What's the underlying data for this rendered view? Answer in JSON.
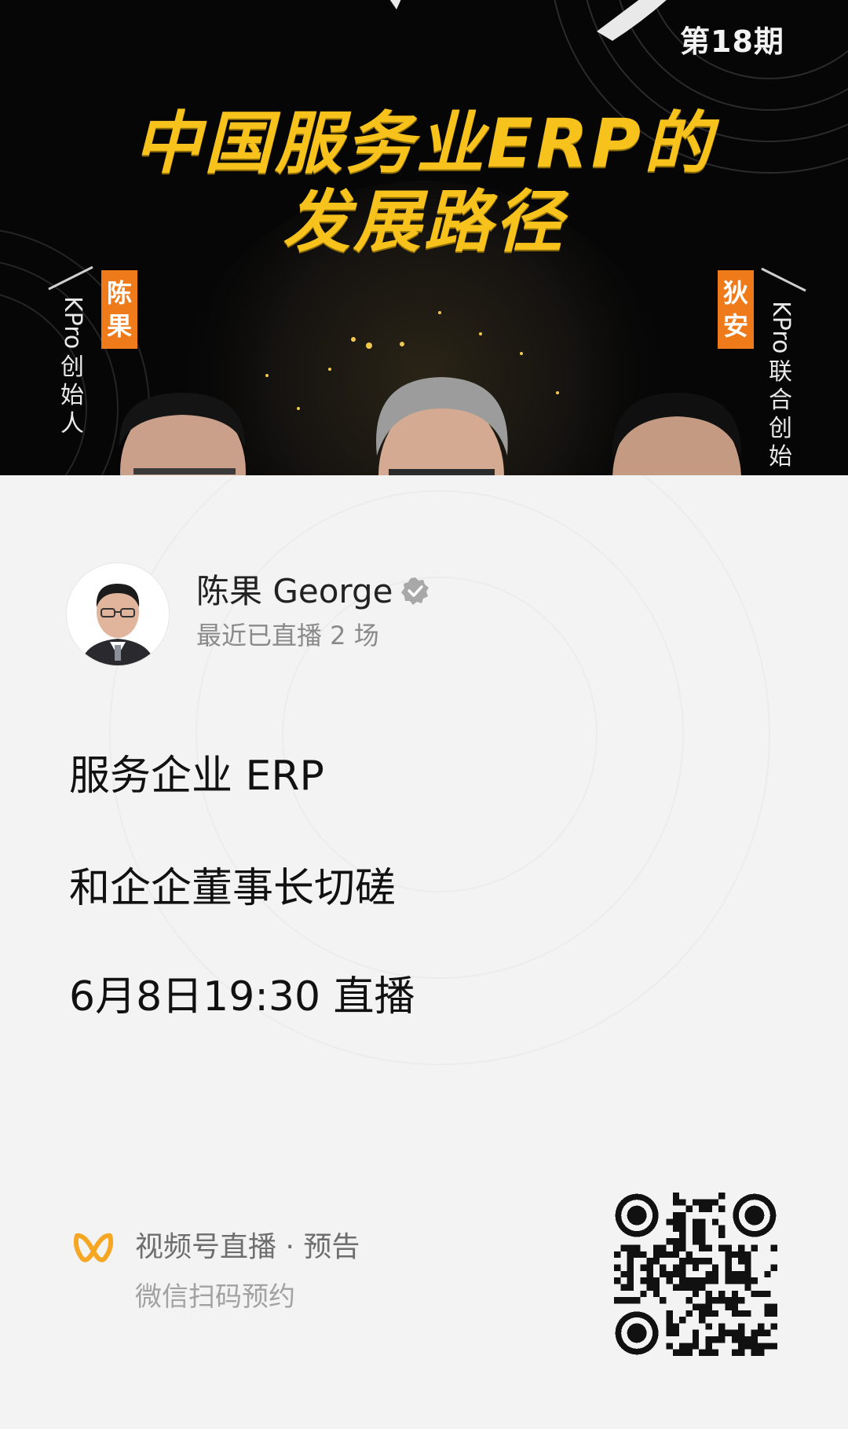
{
  "poster": {
    "issue_label": "第18期",
    "headline_line1": "中国服务业ERP的",
    "headline_line2": "发展路径",
    "left_guest": {
      "name_tag": "陈果",
      "title_prefix": "KPro",
      "title": "创始人"
    },
    "right_guest": {
      "name_tag": "狄安",
      "title_prefix": "KPro",
      "title": "联合创始"
    }
  },
  "author": {
    "name": "陈果 George",
    "subtitle": "最近已直播 2 场",
    "verified_icon": "verified-badge-icon"
  },
  "content": {
    "line1": "服务企业 ERP",
    "line2": "和企企董事长切磋",
    "line3": "6月8日19:30 直播"
  },
  "footer": {
    "logo_icon": "channels-butterfly-icon",
    "title": "视频号直播 · 预告",
    "subtitle": "微信扫码预约",
    "qr_icon": "qr-code-icon"
  },
  "colors": {
    "poster_bg": "#060606",
    "headline_yellow": "#f6c21b",
    "tag_orange": "#ee7a1a",
    "logo_orange": "#f5a623",
    "card_bg": "#f3f3f3"
  }
}
